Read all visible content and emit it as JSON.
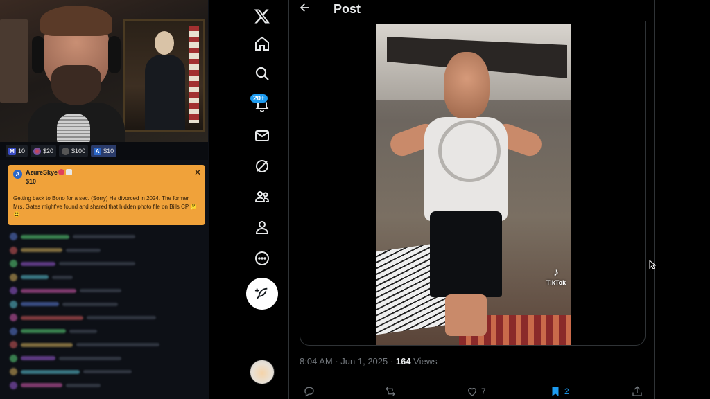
{
  "stream": {
    "gifts": [
      {
        "icon": "M",
        "label": "10"
      },
      {
        "icon": "",
        "label": "$20"
      },
      {
        "icon": "",
        "label": "$100"
      },
      {
        "icon": "A",
        "label": "$10"
      }
    ],
    "donation": {
      "avatar_letter": "A",
      "username": "AzureSkye",
      "amount": "$10",
      "close": "✕",
      "message": "Getting back to Bono for a sec. (Sorry) He divorced in 2024. The former Mrs. Gates might've found and shared that hidden photo file on Bills CP 🤔 😩"
    },
    "chat_colors": [
      "#5b7bd6",
      "#d65b5b",
      "#5bd67b",
      "#d6b15b",
      "#9b5bd6",
      "#5bc4d6",
      "#d65bb0"
    ]
  },
  "nav": {
    "notif_count": "20+",
    "items": [
      "X",
      "Home",
      "Explore",
      "Notifications",
      "Messages",
      "Grok",
      "Communities",
      "Profile",
      "More"
    ]
  },
  "post": {
    "header_title": "Post",
    "tiktok_label": "TikTok",
    "time": "8:04 AM",
    "separator": "·",
    "date": "Jun 1, 2025",
    "views_count": "164",
    "views_label": "Views",
    "likes": "7",
    "bookmarks": "2"
  },
  "colors": {
    "accent": "#1d9bf0",
    "donation_bg": "#f0a23a",
    "background": "#000000"
  }
}
